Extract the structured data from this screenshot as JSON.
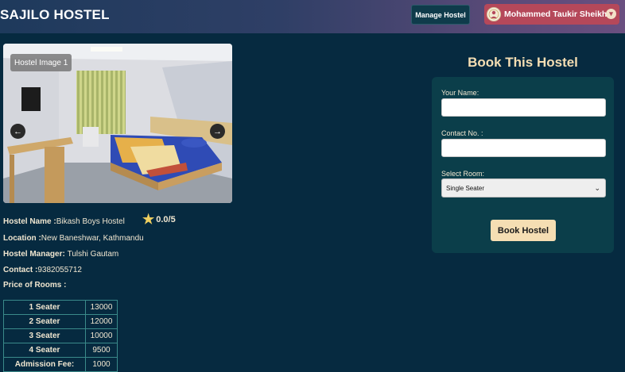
{
  "header": {
    "brand": "SAJILO HOSTEL",
    "manage_label": "Manage Hostel",
    "user_name": "Mohammed Taukir Sheikh",
    "colors": {
      "manage_bg": "#0f3b4b",
      "user_bg": "#b5485a"
    }
  },
  "carousel": {
    "caption": "Hostel Image 1",
    "prev_icon": "arrow-left-icon",
    "next_icon": "arrow-right-icon"
  },
  "hostel": {
    "name_label": "Hostel Name :",
    "name_value": "Bikash Boys Hostel",
    "rating": "0.0/5",
    "location_label": "Location :",
    "location_value": "New Baneshwar, Kathmandu",
    "manager_label": "Hostel Manager: ",
    "manager_value": "Tulshi Gautam",
    "contact_label": "Contact :",
    "contact_value": "9382055712",
    "price_heading": "Price of Rooms :"
  },
  "prices": [
    {
      "label": "1 Seater",
      "value": "13000"
    },
    {
      "label": "2 Seater",
      "value": "12000"
    },
    {
      "label": "3 Seater",
      "value": "10000"
    },
    {
      "label": "4 Seater",
      "value": "9500"
    },
    {
      "label": "Admission Fee:",
      "value": "1000"
    }
  ],
  "booking": {
    "title": "Book This Hostel",
    "name_label": "Your Name:",
    "name_value": "",
    "contact_label": "Contact No. :",
    "contact_value": "",
    "room_label": "Select Room:",
    "room_selected": "Single Seater",
    "submit_label": "Book Hostel",
    "accent": "#f5deb3"
  }
}
